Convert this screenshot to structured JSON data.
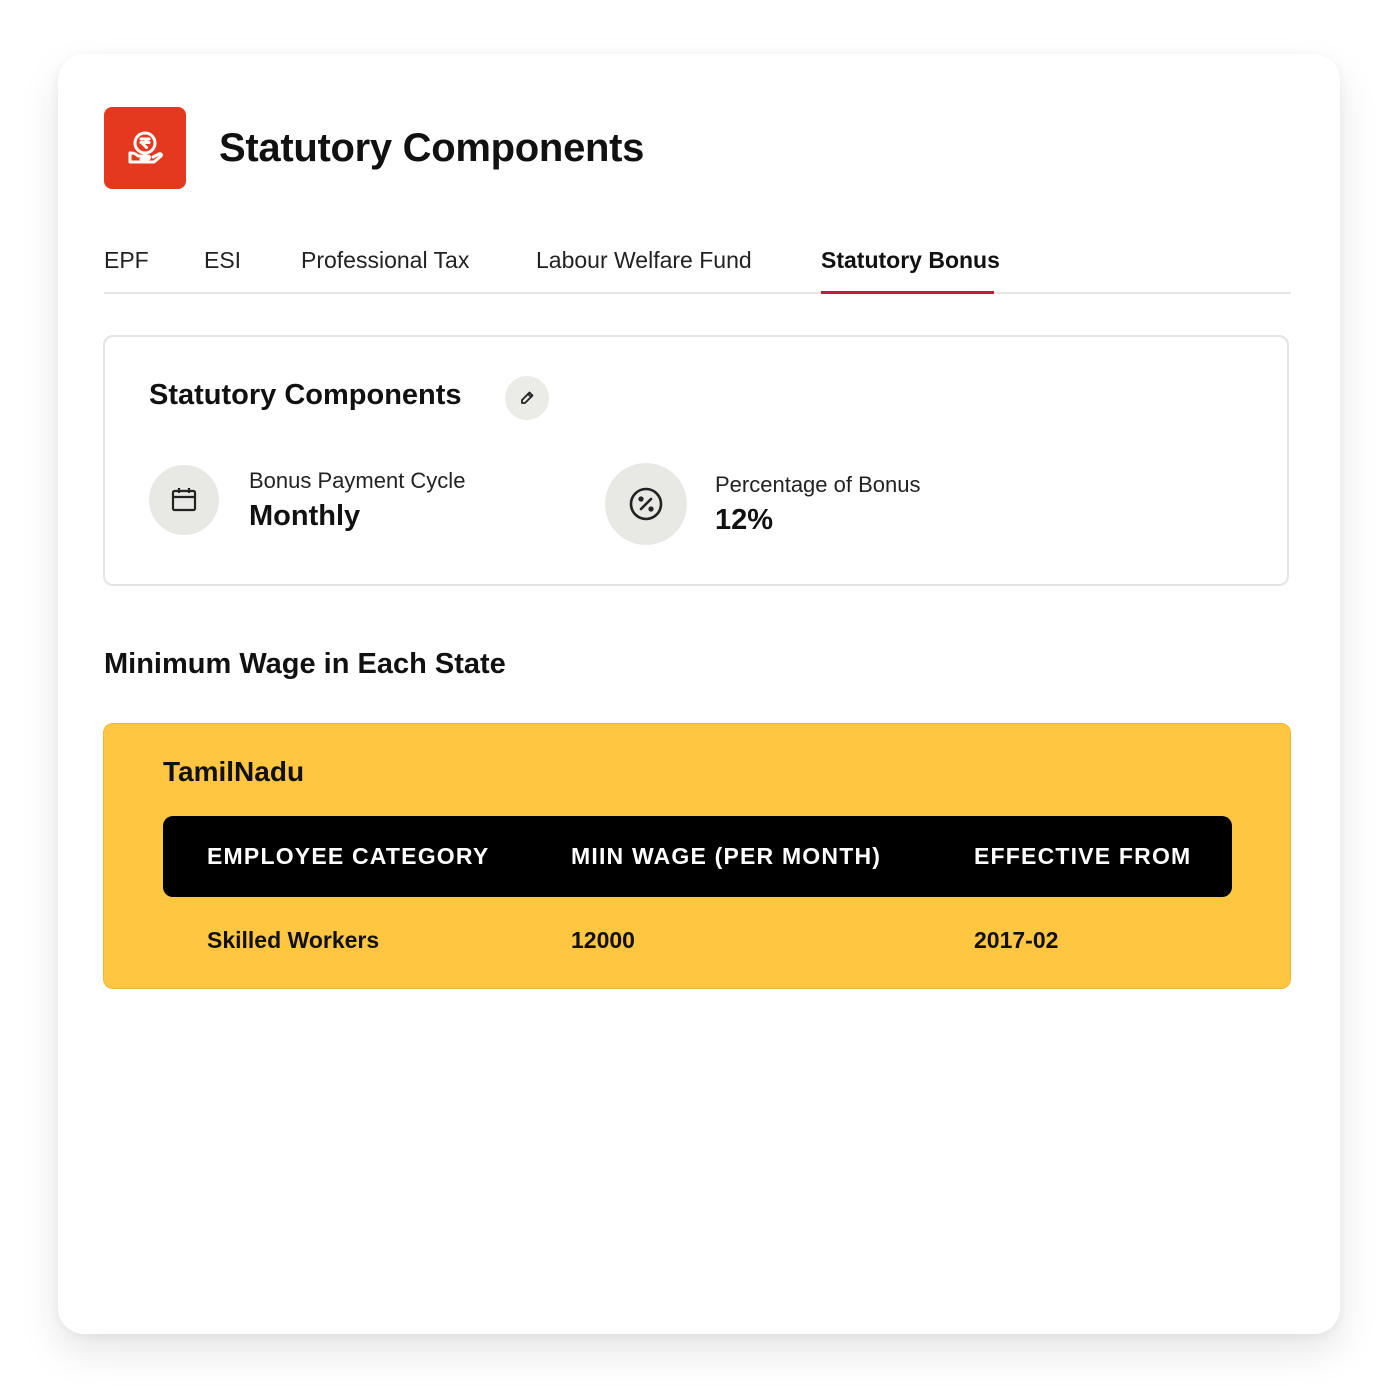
{
  "header": {
    "title": "Statutory Components",
    "icon": "rupee-hand-icon",
    "accent_color": "#e5391f"
  },
  "tabs": [
    {
      "label": "EPF",
      "active": false
    },
    {
      "label": "ESI",
      "active": false
    },
    {
      "label": "Professional Tax",
      "active": false
    },
    {
      "label": "Labour Welfare Fund",
      "active": false
    },
    {
      "label": "Statutory Bonus",
      "active": true
    }
  ],
  "tab_indicator_color": "#c21f2a",
  "summary": {
    "title": "Statutory Components",
    "edit_icon": "pencil-icon",
    "items": [
      {
        "icon": "calendar-icon",
        "label": "Bonus Payment Cycle",
        "value": "Monthly"
      },
      {
        "icon": "percent-icon",
        "label": "Percentage of Bonus",
        "value": "12%"
      }
    ]
  },
  "minimum_wage": {
    "section_title": "Minimum Wage in Each State",
    "state_color": "#ffc642",
    "state": "TamilNadu",
    "columns": [
      "EMPLOYEE CATEGORY",
      "MIIN WAGE (PER MONTH)",
      "EFFECTIVE FROM"
    ],
    "rows": [
      [
        "Skilled Workers",
        "12000",
        "2017-02"
      ]
    ]
  }
}
